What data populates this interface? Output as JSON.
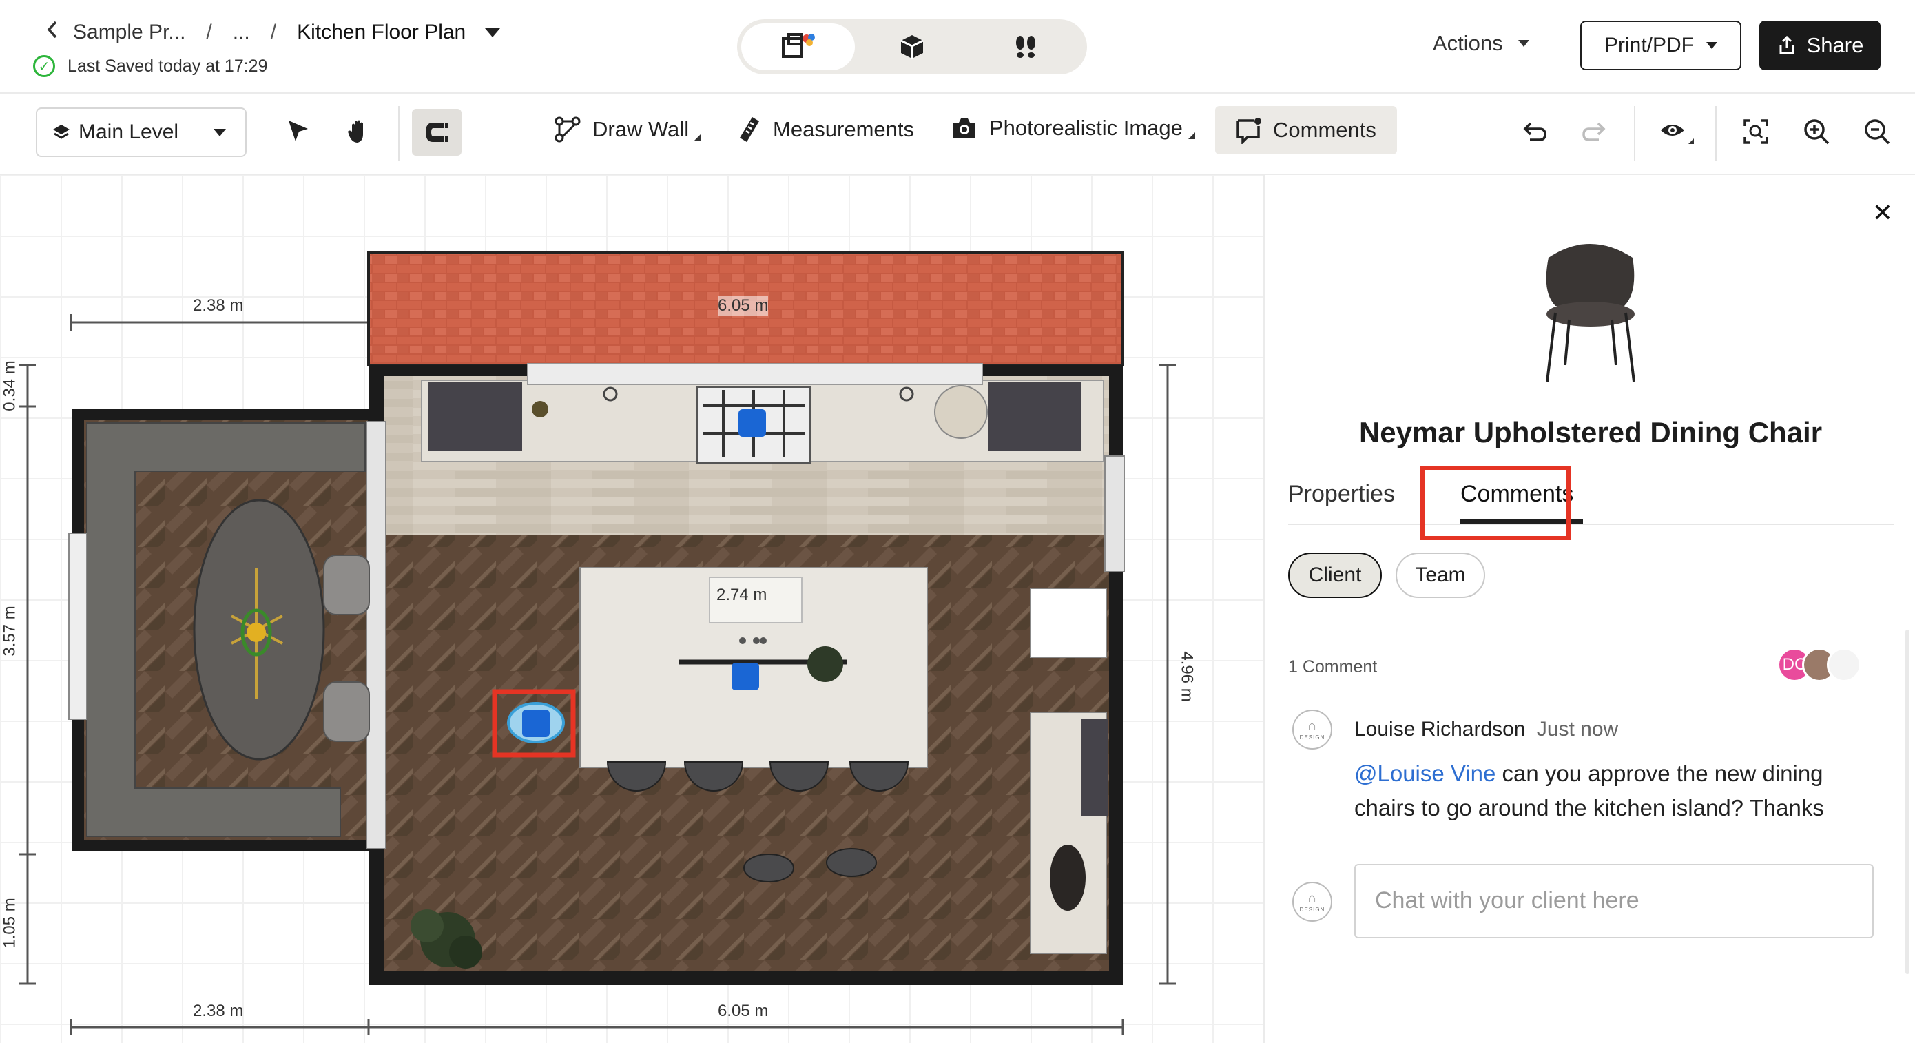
{
  "header": {
    "back_label": "Sample Pr...",
    "ellipsis": "...",
    "sep": "/",
    "project_title": "Kitchen Floor Plan",
    "saved_status": "Last Saved today at 17:29",
    "actions_label": "Actions",
    "print_label": "Print/PDF",
    "share_label": "Share"
  },
  "toolbar": {
    "level_label": "Main Level",
    "draw_wall": "Draw Wall",
    "measurements": "Measurements",
    "photorealistic": "Photorealistic Image",
    "comments": "Comments"
  },
  "canvas": {
    "dims": {
      "top_left": "2.38 m",
      "top_wall": "6.05 m",
      "left_small": "0.34 m",
      "left_mid": "3.57 m",
      "left_bottom": "1.05 m",
      "right": "4.96 m",
      "bottom_left": "2.38 m",
      "bottom_right": "6.05 m",
      "island": "2.74 m"
    }
  },
  "panel": {
    "product_title": "Neymar Upholstered Dining Chair",
    "tab_properties": "Properties",
    "tab_comments": "Comments",
    "pill_client": "Client",
    "pill_team": "Team",
    "comment_count": "1 Comment",
    "avatar_initials": "DC",
    "logo_text": "DESIGN",
    "comment": {
      "author": "Louise Richardson",
      "time": "Just now",
      "mention": "@Louise Vine",
      "text": " can you approve the new dining chairs to go around the kitchen island? Thanks"
    },
    "chat_placeholder": "Chat with your client here"
  },
  "colors": {
    "accent_highlight": "#e53424",
    "mention_blue": "#2d6ed1",
    "comment_marker": "#1a66d4",
    "saved_green": "#2db53b",
    "avatar_pink": "#e94b9c"
  },
  "icons": [
    "chevron-left-icon",
    "chevron-down-icon",
    "check-circle-icon",
    "plan-2d-icon",
    "view-3d-icon",
    "walkthrough-icon",
    "share-icon",
    "layers-icon",
    "pointer-icon",
    "pan-hand-icon",
    "magnet-icon",
    "draw-wall-icon",
    "ruler-icon",
    "camera-icon",
    "comment-icon",
    "undo-icon",
    "redo-icon",
    "eye-icon",
    "fit-icon",
    "zoom-in-icon",
    "zoom-out-icon",
    "close-icon"
  ]
}
